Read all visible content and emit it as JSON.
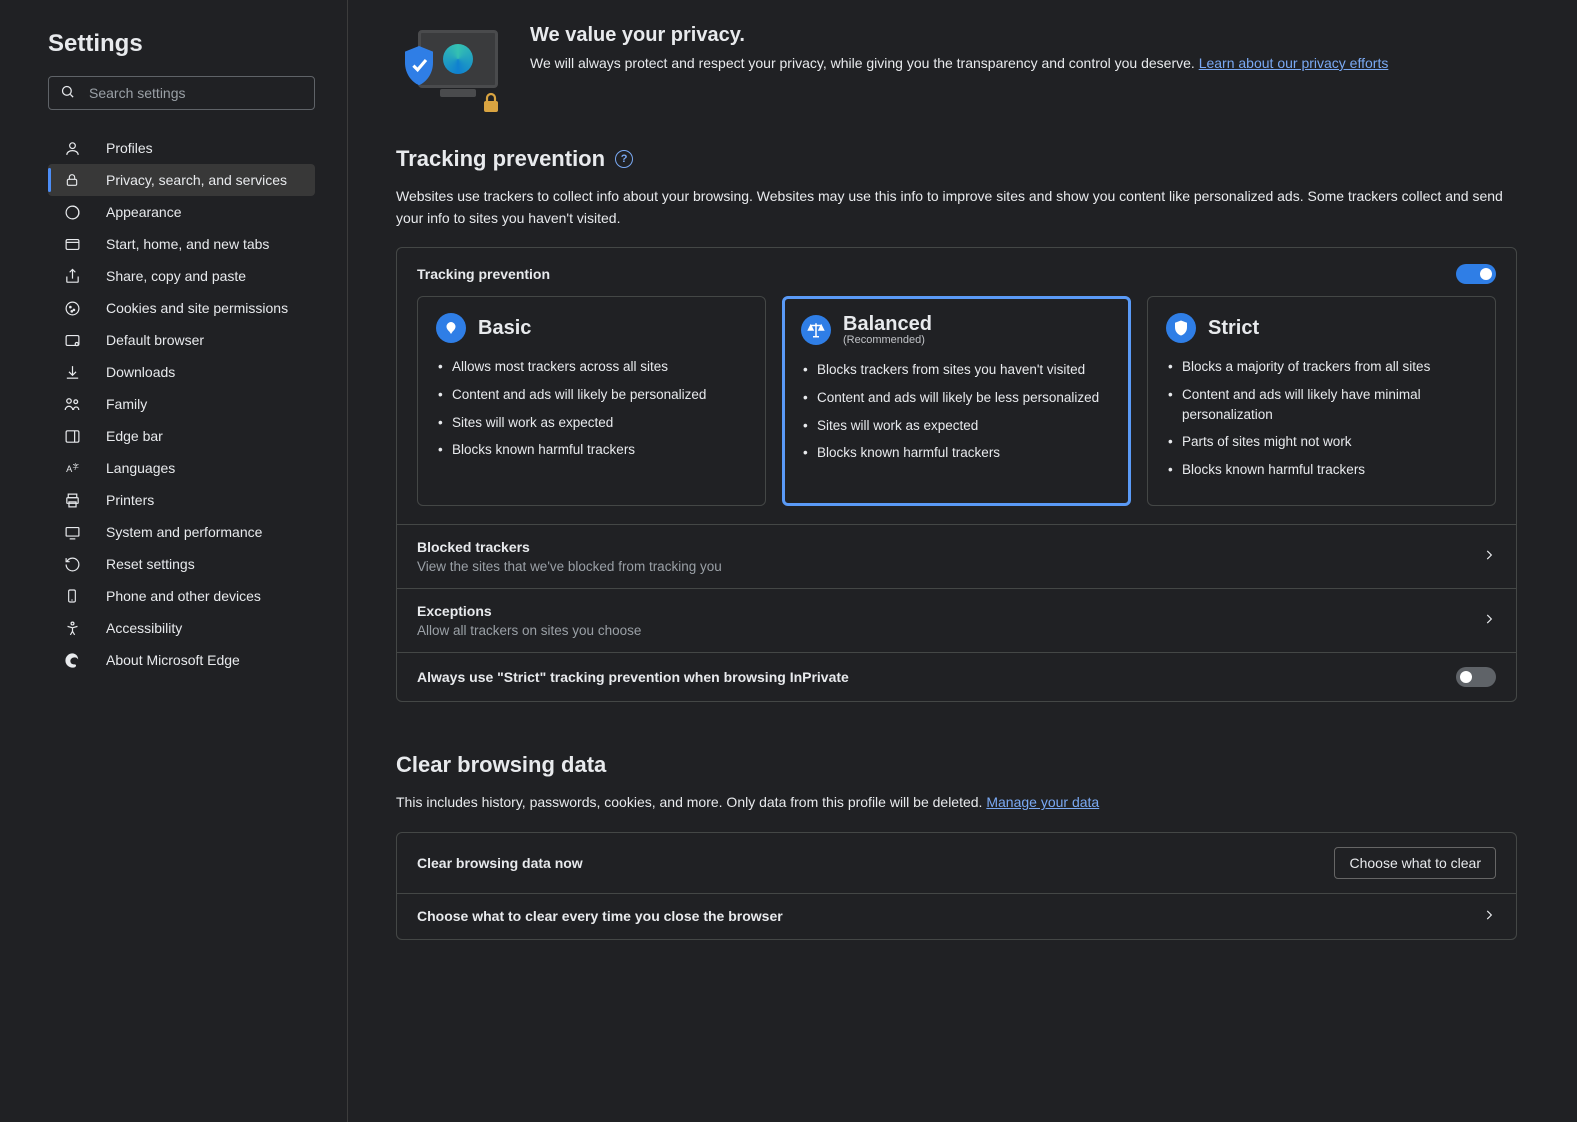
{
  "sidebar": {
    "title": "Settings",
    "search_placeholder": "Search settings",
    "items": [
      {
        "label": "Profiles"
      },
      {
        "label": "Privacy, search, and services"
      },
      {
        "label": "Appearance"
      },
      {
        "label": "Start, home, and new tabs"
      },
      {
        "label": "Share, copy and paste"
      },
      {
        "label": "Cookies and site permissions"
      },
      {
        "label": "Default browser"
      },
      {
        "label": "Downloads"
      },
      {
        "label": "Family"
      },
      {
        "label": "Edge bar"
      },
      {
        "label": "Languages"
      },
      {
        "label": "Printers"
      },
      {
        "label": "System and performance"
      },
      {
        "label": "Reset settings"
      },
      {
        "label": "Phone and other devices"
      },
      {
        "label": "Accessibility"
      },
      {
        "label": "About Microsoft Edge"
      }
    ]
  },
  "hero": {
    "title": "We value your privacy.",
    "text1": "We will always protect and respect your privacy, while giving you the transparency and control you deserve. ",
    "link": "Learn about our privacy efforts"
  },
  "tracking": {
    "title": "Tracking prevention",
    "desc": "Websites use trackers to collect info about your browsing. Websites may use this info to improve sites and show you content like personalized ads. Some trackers collect and send your info to sites you haven't visited.",
    "toggle_label": "Tracking prevention",
    "toggle_on": true,
    "options": [
      {
        "title": "Basic",
        "sub": "",
        "bullets": [
          "Allows most trackers across all sites",
          "Content and ads will likely be personalized",
          "Sites will work as expected",
          "Blocks known harmful trackers"
        ]
      },
      {
        "title": "Balanced",
        "sub": "(Recommended)",
        "bullets": [
          "Blocks trackers from sites you haven't visited",
          "Content and ads will likely be less personalized",
          "Sites will work as expected",
          "Blocks known harmful trackers"
        ]
      },
      {
        "title": "Strict",
        "sub": "",
        "bullets": [
          "Blocks a majority of trackers from all sites",
          "Content and ads will likely have minimal personalization",
          "Parts of sites might not work",
          "Blocks known harmful trackers"
        ]
      }
    ],
    "blocked": {
      "title": "Blocked trackers",
      "sub": "View the sites that we've blocked from tracking you"
    },
    "exceptions": {
      "title": "Exceptions",
      "sub": "Allow all trackers on sites you choose"
    },
    "strict_inprivate": "Always use \"Strict\" tracking prevention when browsing InPrivate",
    "strict_inprivate_on": false
  },
  "clear": {
    "title": "Clear browsing data",
    "desc1": "This includes history, passwords, cookies, and more. Only data from this profile will be deleted. ",
    "link": "Manage your data",
    "now": "Clear browsing data now",
    "choose_btn": "Choose what to clear",
    "every_close": "Choose what to clear every time you close the browser"
  }
}
